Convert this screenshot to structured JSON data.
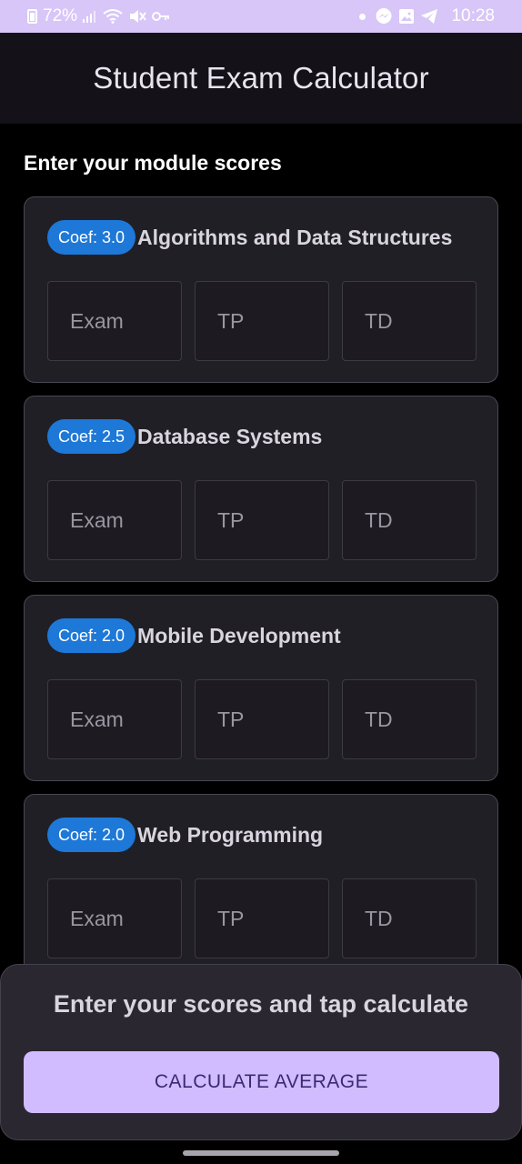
{
  "status_bar": {
    "battery": "72%",
    "time": "10:28",
    "left_icons": [
      "battery-icon",
      "signal-icon",
      "wifi-icon",
      "mute-icon",
      "key-icon"
    ],
    "right_icons": [
      "notification-dot-icon",
      "messenger-icon",
      "gallery-icon",
      "telegram-icon"
    ]
  },
  "app_bar": {
    "title": "Student Exam Calculator"
  },
  "section": {
    "heading": "Enter your module scores"
  },
  "modules": [
    {
      "coef": "Coef: 3.0",
      "name": "Algorithms and Data Structures",
      "exam_placeholder": "Exam",
      "tp_placeholder": "TP",
      "td_placeholder": "TD"
    },
    {
      "coef": "Coef: 2.5",
      "name": "Database Systems",
      "exam_placeholder": "Exam",
      "tp_placeholder": "TP",
      "td_placeholder": "TD"
    },
    {
      "coef": "Coef: 2.0",
      "name": "Mobile Development",
      "exam_placeholder": "Exam",
      "tp_placeholder": "TP",
      "td_placeholder": "TD"
    },
    {
      "coef": "Coef: 2.0",
      "name": "Web Programming",
      "exam_placeholder": "Exam",
      "tp_placeholder": "TP",
      "td_placeholder": "TD"
    }
  ],
  "bottom": {
    "result_text": "Enter your scores and tap calculate",
    "button_label": "CALCULATE AVERAGE"
  },
  "colors": {
    "status_bar": "#d7c6f7",
    "coef_badge": "#1e78d7",
    "button": "#d0bcff",
    "button_text": "#3b2a72",
    "card": "#211f26"
  }
}
